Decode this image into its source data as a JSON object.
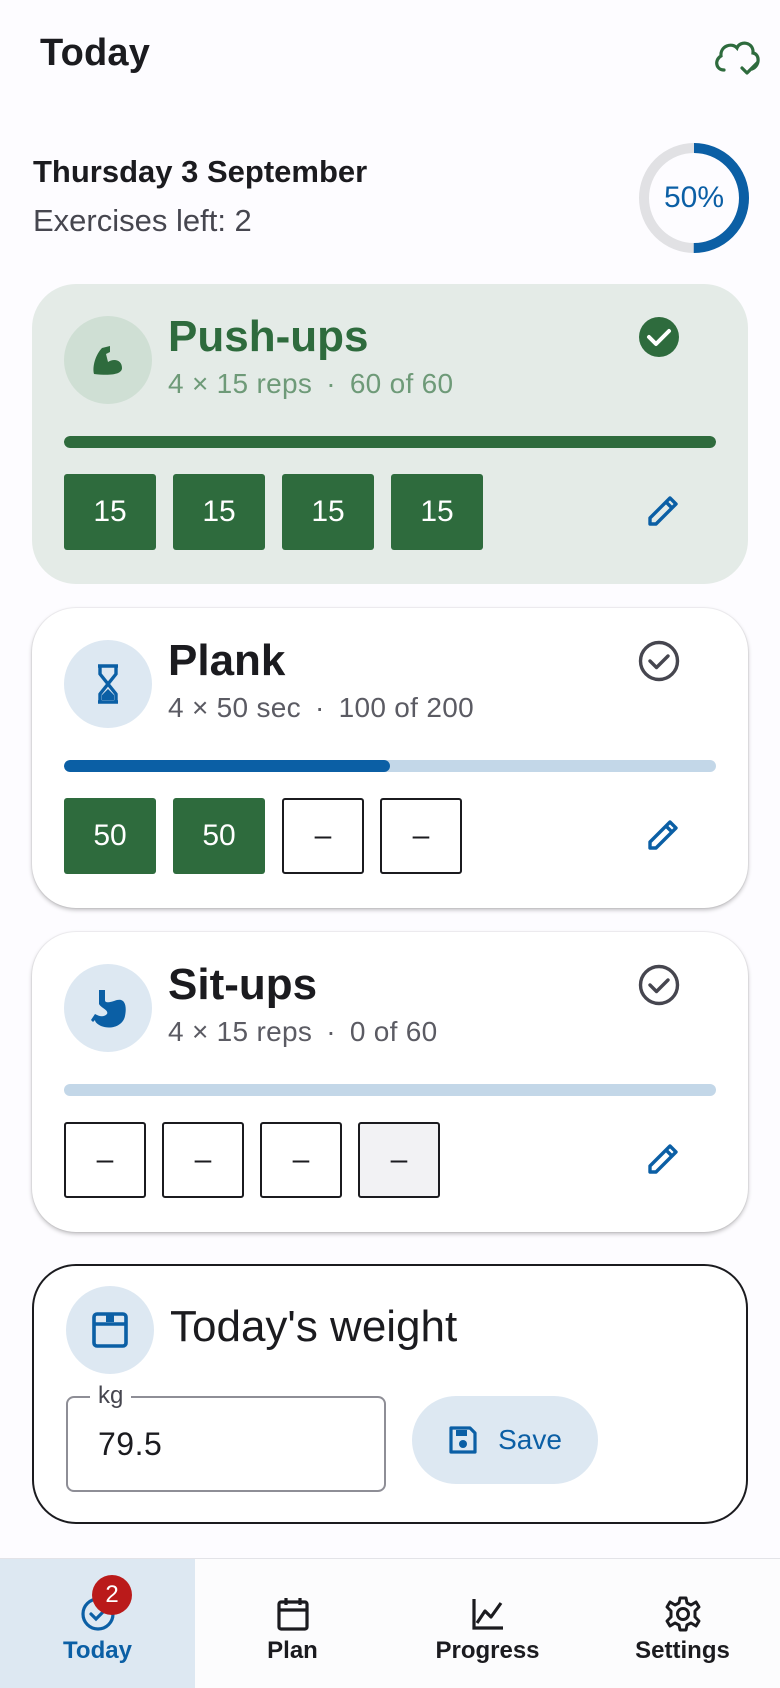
{
  "header": {
    "title": "Today",
    "sync_icon": "cloud-done-icon"
  },
  "summary": {
    "date": "Thursday 3 September",
    "exercises_left": "Exercises left: 2",
    "progress_label": "50%",
    "progress_fraction": 0.5
  },
  "colors": {
    "accent": "#0b5fa5",
    "done_green": "#2e6b3d",
    "badge_red": "#ba1a1a"
  },
  "exercises": [
    {
      "name": "Push-ups",
      "scheme": "4 × 15 reps",
      "dot": "·",
      "total": "60 of 60",
      "icon": "bicep-icon",
      "completed": true,
      "progress": 1.0,
      "sets": [
        "15",
        "15",
        "15",
        "15"
      ]
    },
    {
      "name": "Plank",
      "scheme": "4 × 50 sec",
      "dot": "·",
      "total": "100 of 200",
      "icon": "hourglass-icon",
      "completed": false,
      "progress": 0.5,
      "sets": [
        "50",
        "50",
        "–",
        "–"
      ]
    },
    {
      "name": "Sit-ups",
      "scheme": "4 × 15 reps",
      "dot": "·",
      "total": "0 of 60",
      "icon": "stomach-icon",
      "completed": false,
      "progress": 0.0,
      "sets": [
        "–",
        "–",
        "–",
        "–"
      ]
    }
  ],
  "weight": {
    "title": "Today's weight",
    "unit_label": "kg",
    "value": "79.5",
    "save_label": "Save"
  },
  "nav": {
    "items": [
      {
        "label": "Today",
        "icon": "check-circle-icon",
        "active": true,
        "badge": "2"
      },
      {
        "label": "Plan",
        "icon": "calendar-icon"
      },
      {
        "label": "Progress",
        "icon": "chart-icon"
      },
      {
        "label": "Settings",
        "icon": "gear-icon"
      }
    ]
  }
}
